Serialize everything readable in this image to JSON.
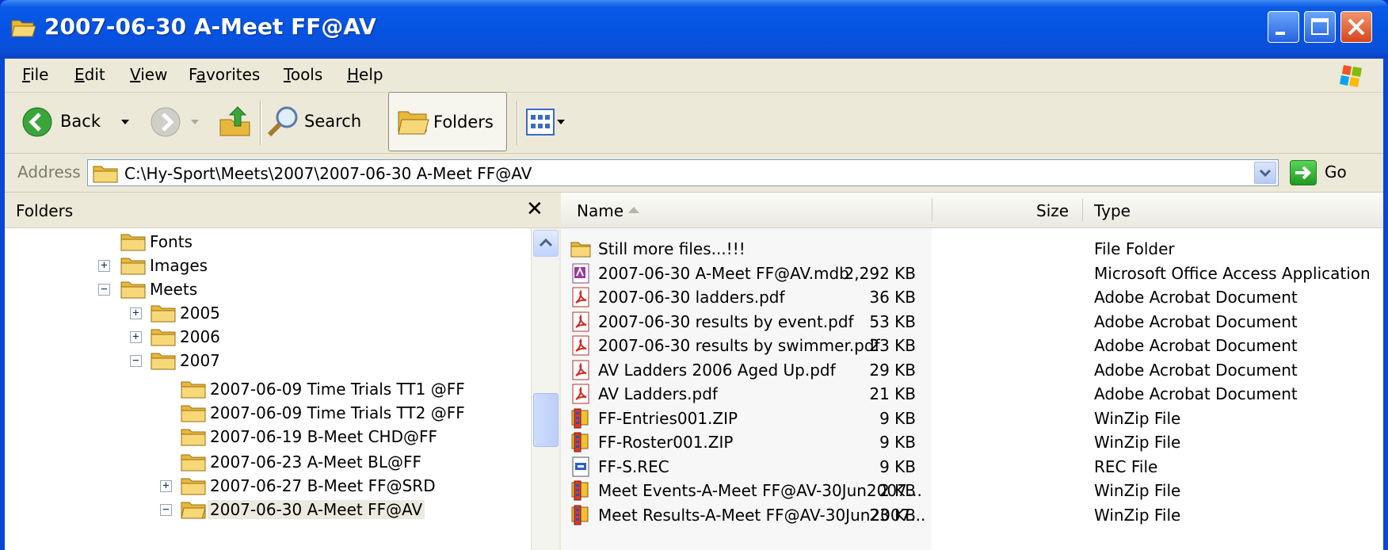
{
  "window": {
    "title": "2007-06-30 A-Meet FF@AV"
  },
  "menu": [
    {
      "label": "File",
      "u": "F",
      "rest": "ile"
    },
    {
      "label": "Edit",
      "u": "E",
      "rest": "dit"
    },
    {
      "label": "View",
      "u": "V",
      "rest": "iew"
    },
    {
      "label": "Favorites",
      "u": "a",
      "pre": "F",
      "rest": "vorites"
    },
    {
      "label": "Tools",
      "u": "T",
      "rest": "ools"
    },
    {
      "label": "Help",
      "u": "H",
      "rest": "elp"
    }
  ],
  "toolbar": {
    "back": "Back",
    "search": "Search",
    "folders": "Folders"
  },
  "address": {
    "label": "Address",
    "path": "C:\\Hy-Sport\\Meets\\2007\\2007-06-30 A-Meet FF@AV",
    "go": "Go"
  },
  "folders_pane": {
    "title": "Folders",
    "close_glyph": "✕",
    "items": [
      {
        "label": "Fonts",
        "expander": ""
      },
      {
        "label": "Images",
        "expander": "+"
      },
      {
        "label": "Meets",
        "expander": "−"
      },
      {
        "label": "2005",
        "expander": "+"
      },
      {
        "label": "2006",
        "expander": "+"
      },
      {
        "label": "2007",
        "expander": "−"
      },
      {
        "label": "2007-06-09 Time Trials TT1 @FF",
        "expander": ""
      },
      {
        "label": "2007-06-09 Time Trials TT2 @FF",
        "expander": ""
      },
      {
        "label": "2007-06-19 B-Meet CHD@FF",
        "expander": ""
      },
      {
        "label": "2007-06-23 A-Meet BL@FF",
        "expander": ""
      },
      {
        "label": "2007-06-27 B-Meet FF@SRD",
        "expander": "+"
      },
      {
        "label": "2007-06-30 A-Meet FF@AV",
        "expander": "−",
        "selected": true
      }
    ]
  },
  "files": {
    "columns": {
      "name": "Name",
      "size": "Size",
      "type": "Type"
    },
    "rows": [
      {
        "name": "Still more files...!!!",
        "size": "",
        "type": "File Folder",
        "icon": "folder-icon"
      },
      {
        "name": "2007-06-30 A-Meet FF@AV.mdb",
        "size": "2,292 KB",
        "type": "Microsoft Office Access Application",
        "icon": "access-db-icon"
      },
      {
        "name": "2007-06-30 ladders.pdf",
        "size": "36 KB",
        "type": "Adobe Acrobat Document",
        "icon": "pdf-icon"
      },
      {
        "name": "2007-06-30 results by event.pdf",
        "size": "53 KB",
        "type": "Adobe Acrobat Document",
        "icon": "pdf-icon"
      },
      {
        "name": "2007-06-30 results by swimmer.pdf",
        "size": "23 KB",
        "type": "Adobe Acrobat Document",
        "icon": "pdf-icon"
      },
      {
        "name": "AV Ladders 2006 Aged Up.pdf",
        "size": "29 KB",
        "type": "Adobe Acrobat Document",
        "icon": "pdf-icon"
      },
      {
        "name": "AV Ladders.pdf",
        "size": "21 KB",
        "type": "Adobe Acrobat Document",
        "icon": "pdf-icon"
      },
      {
        "name": "FF-Entries001.ZIP",
        "size": "9 KB",
        "type": "WinZip File",
        "icon": "zip-icon"
      },
      {
        "name": "FF-Roster001.ZIP",
        "size": "9 KB",
        "type": "WinZip File",
        "icon": "zip-icon"
      },
      {
        "name": "FF-S.REC",
        "size": "9 KB",
        "type": "REC File",
        "icon": "rec-file-icon"
      },
      {
        "name": "Meet Events-A-Meet FF@AV-30Jun2007...",
        "size": "2 KB",
        "type": "WinZip File",
        "icon": "zip-icon"
      },
      {
        "name": "Meet Results-A-Meet FF@AV-30Jun2007...",
        "size": "23 KB",
        "type": "WinZip File",
        "icon": "zip-icon"
      }
    ]
  },
  "colors": {
    "title_bar": "#0553e3",
    "chrome": "#ece9d8"
  }
}
